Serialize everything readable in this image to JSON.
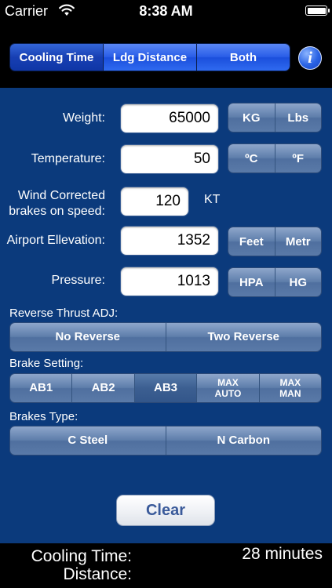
{
  "status": {
    "carrier": "Carrier",
    "time": "8:38 AM",
    "icons": [
      "wifi-icon",
      "battery-icon"
    ]
  },
  "mode_tabs": {
    "items": [
      "Cooling Time",
      "Ldg Distance",
      "Both"
    ],
    "selected": "Cooling Time",
    "info_label": "i"
  },
  "form": {
    "weight": {
      "label": "Weight:",
      "value": "65000",
      "units": [
        "KG",
        "Lbs"
      ]
    },
    "temperature": {
      "label": "Temperature:",
      "value": "50",
      "units": [
        "ºC",
        "ºF"
      ]
    },
    "speed": {
      "label_line1": "Wind Corrected",
      "label_line2": "brakes on speed:",
      "value": "120",
      "unit": "KT"
    },
    "elevation": {
      "label": "Airport Ellevation:",
      "value": "1352",
      "units": [
        "Feet",
        "Metr"
      ]
    },
    "pressure": {
      "label": "Pressure:",
      "value": "1013",
      "units": [
        "HPA",
        "HG"
      ]
    }
  },
  "reverse_thrust": {
    "title": "Reverse Thrust ADJ:",
    "options": [
      "No Reverse",
      "Two Reverse"
    ]
  },
  "brake_setting": {
    "title": "Brake Setting:",
    "options": [
      {
        "line1": "AB1",
        "line2": ""
      },
      {
        "line1": "AB2",
        "line2": ""
      },
      {
        "line1": "AB3",
        "line2": ""
      },
      {
        "line1": "MAX",
        "line2": "AUTO"
      },
      {
        "line1": "MAX",
        "line2": "MAN"
      }
    ],
    "selected": "AB3"
  },
  "brakes_type": {
    "title": "Brakes Type:",
    "options": [
      "C Steel",
      "N Carbon"
    ]
  },
  "clear_label": "Clear",
  "results": {
    "cooling_label": "Cooling Time:",
    "cooling_value": "28 minutes",
    "distance_label": "Distance:"
  }
}
